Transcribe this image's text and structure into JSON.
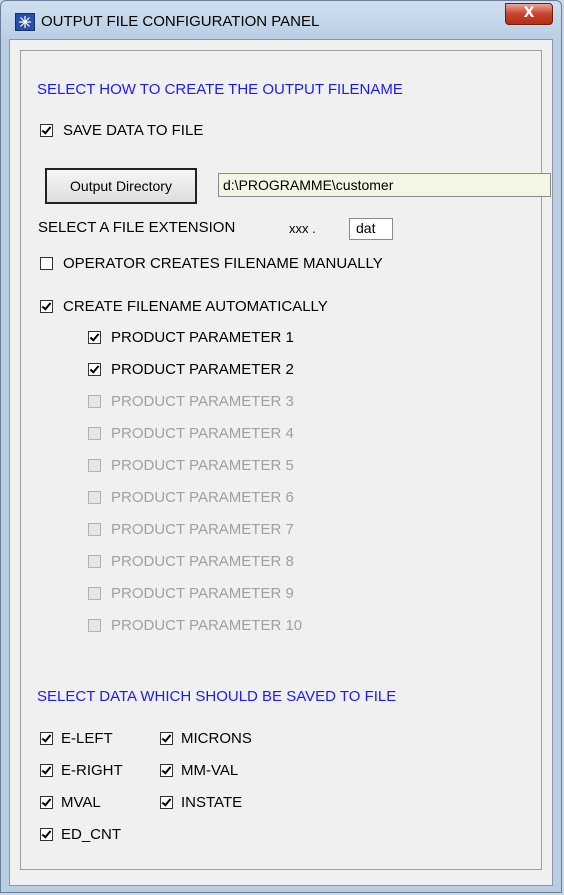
{
  "window": {
    "title": "OUTPUT FILE CONFIGURATION PANEL",
    "close_label": "X"
  },
  "filename_section": {
    "heading": "SELECT HOW TO CREATE THE OUTPUT FILENAME",
    "save_data_label": "SAVE DATA TO FILE",
    "output_directory_button": "Output Directory",
    "output_directory_value": "d:\\PROGRAMME\\customer",
    "extension_label": "SELECT A FILE EXTENSION",
    "extension_prefix": "xxx .",
    "extension_value": "dat",
    "manual_label": "OPERATOR CREATES FILENAME MANUALLY",
    "auto_label": "CREATE FILENAME AUTOMATICALLY",
    "parameters": [
      {
        "label": "PRODUCT PARAMETER 1",
        "checked": true,
        "enabled": true
      },
      {
        "label": "PRODUCT PARAMETER 2",
        "checked": true,
        "enabled": true
      },
      {
        "label": "PRODUCT PARAMETER 3",
        "checked": false,
        "enabled": false
      },
      {
        "label": "PRODUCT PARAMETER 4",
        "checked": false,
        "enabled": false
      },
      {
        "label": "PRODUCT PARAMETER 5",
        "checked": false,
        "enabled": false
      },
      {
        "label": "PRODUCT PARAMETER 6",
        "checked": false,
        "enabled": false
      },
      {
        "label": "PRODUCT PARAMETER 7",
        "checked": false,
        "enabled": false
      },
      {
        "label": "PRODUCT PARAMETER 8",
        "checked": false,
        "enabled": false
      },
      {
        "label": "PRODUCT PARAMETER 9",
        "checked": false,
        "enabled": false
      },
      {
        "label": "PRODUCT PARAMETER 10",
        "checked": false,
        "enabled": false
      }
    ]
  },
  "data_section": {
    "heading": "SELECT DATA WHICH SHOULD BE SAVED TO FILE",
    "items": [
      {
        "label": "E-LEFT",
        "checked": true
      },
      {
        "label": "MICRONS",
        "checked": true
      },
      {
        "label": "E-RIGHT",
        "checked": true
      },
      {
        "label": "MM-VAL",
        "checked": true
      },
      {
        "label": "MVAL",
        "checked": true
      },
      {
        "label": "INSTATE",
        "checked": true
      },
      {
        "label": "ED_CNT",
        "checked": true
      }
    ]
  }
}
